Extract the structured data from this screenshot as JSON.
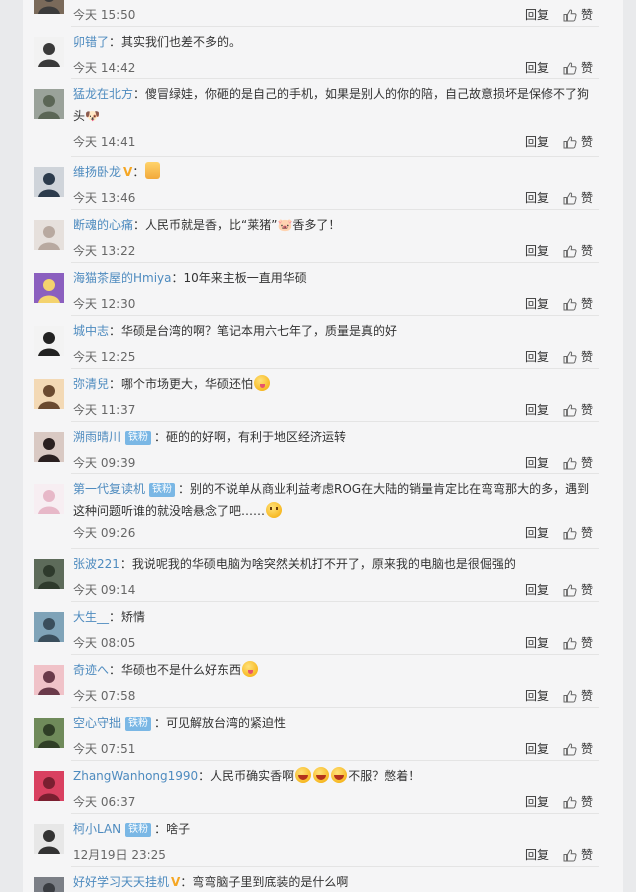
{
  "reply_label": "回复",
  "like_label": "赞",
  "colors": {
    "username": "#4e8bbf",
    "fan_badge": "#7ab7e5",
    "vip": "#f5a623"
  },
  "comments": [
    {
      "user": "",
      "text": "",
      "time": "今天 15:50",
      "avatar_colors": [
        "#7a6a5a",
        "#3b3b3b"
      ]
    },
    {
      "user": "卯错了",
      "text": "：其实我们也差不多的。",
      "time": "今天 14:42",
      "avatar_colors": [
        "#f2f2f2",
        "#3a3a3a"
      ]
    },
    {
      "user": "猛龙在北方",
      "text": "：傻冒绿娃，你砸的是自己的手机，如果是别人的你的陪，自己故意损坏是保修不了狗头🐶",
      "time": "今天 14:41",
      "avatar_colors": [
        "#9aa29a",
        "#5b6656"
      ]
    },
    {
      "user": "维扬卧龙",
      "vip": true,
      "text": "：",
      "emoji": [
        "thumb"
      ],
      "time": "今天 13:46",
      "avatar_colors": [
        "#cfd4da",
        "#2c3b4c"
      ]
    },
    {
      "user": "断魂的心痛",
      "text": "：人民币就是香，比“莱猪”🐷香多了！",
      "time": "今天 13:22",
      "avatar_colors": [
        "#e6e0dc",
        "#b8a9a0"
      ]
    },
    {
      "user": "海猫茶屋的Hmiya",
      "text": "：10年来主板一直用华硕",
      "time": "今天 12:30",
      "avatar_colors": [
        "#8b5fbf",
        "#f4d36e"
      ]
    },
    {
      "user": "城中志",
      "text": "：华硕是台湾的啊？笔记本用六七年了，质量是真的好",
      "time": "今天 12:25",
      "avatar_colors": [
        "#f3f3f3",
        "#222222"
      ]
    },
    {
      "user": "弥清兒",
      "text": "：哪个市场更大，华硕还怕",
      "emoji": [
        "lick"
      ],
      "time": "今天 11:37",
      "avatar_colors": [
        "#f3d9b5",
        "#6b4a2f"
      ]
    },
    {
      "user": "溯雨晴川",
      "fan": "铁粉",
      "text": "：砸的的好啊，有利于地区经济运转",
      "time": "今天 09:39",
      "avatar_colors": [
        "#d9c9c3",
        "#2a2020"
      ]
    },
    {
      "user": "第一代复读机",
      "fan": "铁粉",
      "text": "：别的不说单从商业利益考虑ROG在大陆的销量肯定比在弯弯那大的多，遇到这种问题听谁的就没啥悬念了吧……",
      "emoji": [
        "face"
      ],
      "time": "今天 09:26",
      "avatar_colors": [
        "#f7eef2",
        "#e7b8c8"
      ]
    },
    {
      "user": "张波221",
      "text": "：我说呢我的华硕电脑为啥突然关机打不开了，原来我的电脑也是很倔强的",
      "time": "今天 09:14",
      "avatar_colors": [
        "#5d6b5a",
        "#2e3a2c"
      ]
    },
    {
      "user": "大生__",
      "text": "：矫情",
      "time": "今天 08:05",
      "avatar_colors": [
        "#7fa3b8",
        "#3a4e5c"
      ]
    },
    {
      "user": "奇迹へ",
      "text": "：华硕也不是什么好东西",
      "emoji": [
        "lick"
      ],
      "time": "今天 07:58",
      "avatar_colors": [
        "#f0c2c8",
        "#6a3a4a"
      ]
    },
    {
      "user": "空心守拙",
      "fan": "铁粉",
      "text": "：可见解放台湾的紧迫性",
      "time": "今天 07:51",
      "avatar_colors": [
        "#6f8a5a",
        "#2f3e26"
      ]
    },
    {
      "user": "ZhangWanhong1990",
      "text": "：人民币确实香啊",
      "emoji": [
        "laugh",
        "laugh",
        "laugh"
      ],
      "text_after": "不服？憋着！",
      "time": "今天 06:37",
      "avatar_colors": [
        "#d94060",
        "#7a1f30"
      ]
    },
    {
      "user": "柯小LAN",
      "fan": "铁粉",
      "text": "：啥子",
      "time": "12月19日 23:25",
      "avatar_colors": [
        "#e7e7e7",
        "#333333"
      ]
    },
    {
      "user": "好好学习天天挂机",
      "vip": true,
      "text": "：弯弯脑子里到底装的是什么啊",
      "time": "",
      "avatar_colors": [
        "#7b7f86",
        "#3a3d42"
      ]
    }
  ]
}
